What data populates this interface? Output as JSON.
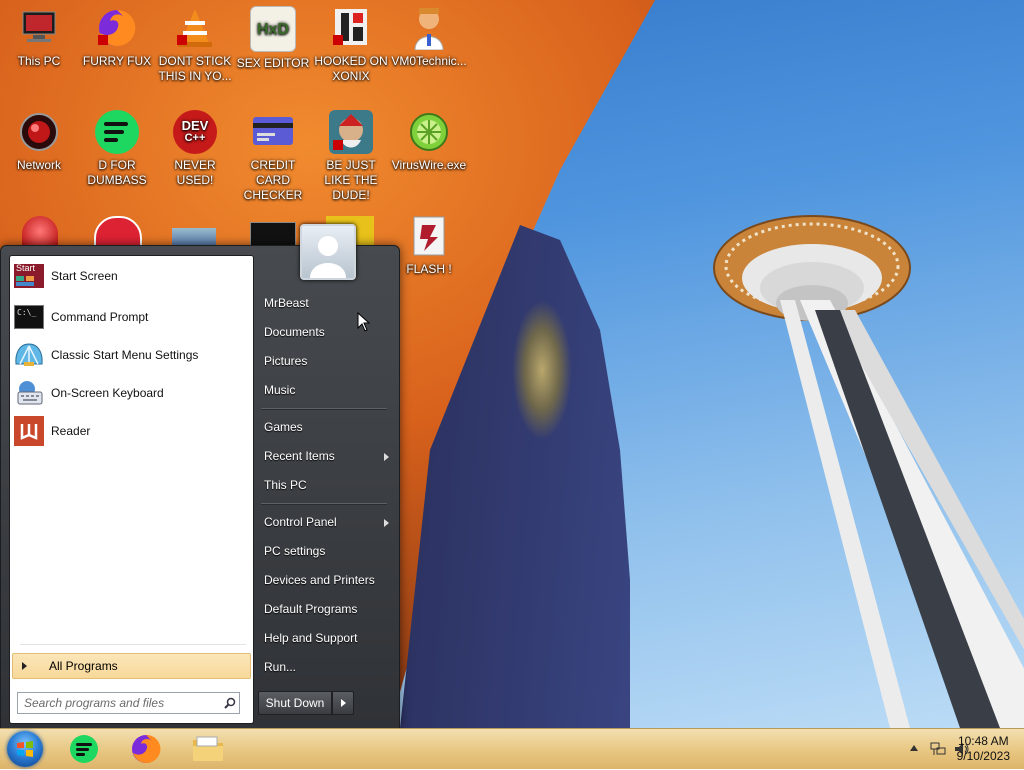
{
  "desktop": {
    "icons": [
      {
        "label": "This PC"
      },
      {
        "label": "FURRY FUX"
      },
      {
        "label": "DONT STICK THIS IN YO..."
      },
      {
        "label": "SEX EDITOR"
      },
      {
        "label": "HOOKED ON XONIX"
      },
      {
        "label": "VM0Technic..."
      },
      {
        "label": "Network"
      },
      {
        "label": "D FOR DUMBASS"
      },
      {
        "label": "NEVER USED!"
      },
      {
        "label": "CREDIT CARD CHECKER"
      },
      {
        "label": "BE JUST LIKE THE DUDE!"
      },
      {
        "label": "VirusWire.exe"
      },
      {
        "label": "FLASH !"
      }
    ],
    "icon_text": {
      "dev": "DEV",
      "cpp": "C++",
      "hxd": "HxD"
    }
  },
  "start_menu": {
    "programs": [
      {
        "label": "Start Screen",
        "icon": "start-screen-icon",
        "badge": "Start"
      },
      {
        "label": "Command Prompt",
        "icon": "command-prompt-icon",
        "badge": "C:\\_"
      },
      {
        "label": "Classic Start Menu Settings",
        "icon": "shell-icon"
      },
      {
        "label": "On-Screen Keyboard",
        "icon": "keyboard-icon"
      },
      {
        "label": "Reader",
        "icon": "reader-icon"
      }
    ],
    "all_programs": "All Programs",
    "search_placeholder": "Search programs and files",
    "right_items": {
      "user": "MrBeast",
      "documents": "Documents",
      "pictures": "Pictures",
      "music": "Music",
      "games": "Games",
      "recent_items": "Recent Items",
      "this_pc": "This PC",
      "control_panel": "Control Panel",
      "pc_settings": "PC settings",
      "devices_printers": "Devices and Printers",
      "default_programs": "Default Programs",
      "help_support": "Help and Support",
      "run": "Run..."
    },
    "shut_down": "Shut Down"
  },
  "taskbar": {
    "pinned": [
      "spotify-icon",
      "firefox-icon",
      "file-explorer-icon"
    ],
    "clock": {
      "time": "10:48 AM",
      "date": "9/10/2023"
    }
  },
  "colors": {
    "taskbar": "#e9c985",
    "highlight": "#f8d899",
    "menu_dark": "#393c40"
  }
}
